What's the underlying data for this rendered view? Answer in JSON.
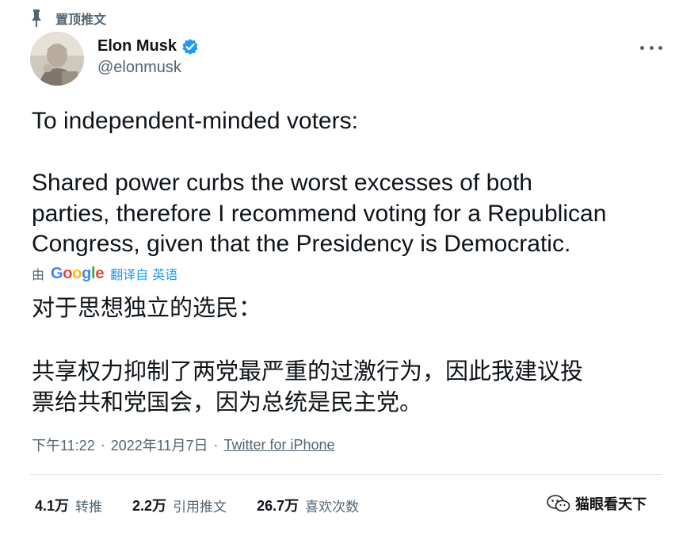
{
  "pinned": {
    "label": "置顶推文"
  },
  "author": {
    "display_name": "Elon Musk",
    "handle": "@elonmusk",
    "verified": true
  },
  "tweet": {
    "text_line1": "To independent-minded voters:",
    "text_para2": [
      "Shared power curbs the worst excesses of both",
      "parties, therefore I recommend voting for a Republican",
      "Congress, given that the Presidency is Democratic."
    ]
  },
  "translation": {
    "by": "由",
    "provider": "Google",
    "link": "翻译自 英语",
    "line1": "对于思想独立的选民：",
    "para2": [
      "共享权力抑制了两党最严重的过激行为，因此我建议投",
      "票给共和党国会，因为总统是民主党。"
    ]
  },
  "meta": {
    "time": "下午11:22",
    "separator": "·",
    "date": "2022年11月7日",
    "source": "Twitter for iPhone"
  },
  "stats": {
    "retweets": {
      "count": "4.1万",
      "label": "转推"
    },
    "quotes": {
      "count": "2.2万",
      "label": "引用推文"
    },
    "likes": {
      "count": "26.7万",
      "label": "喜欢次数"
    }
  },
  "watermark": {
    "text": "猫眼看天下"
  },
  "colors": {
    "text": "#0f1419",
    "secondary": "#536471",
    "link": "#1d9bf0",
    "verified": "#1d9bf0",
    "divider": "#e4e9ed"
  },
  "icons": [
    "pin-icon",
    "verified-badge-icon",
    "more-options-icon",
    "wechat-icon"
  ]
}
